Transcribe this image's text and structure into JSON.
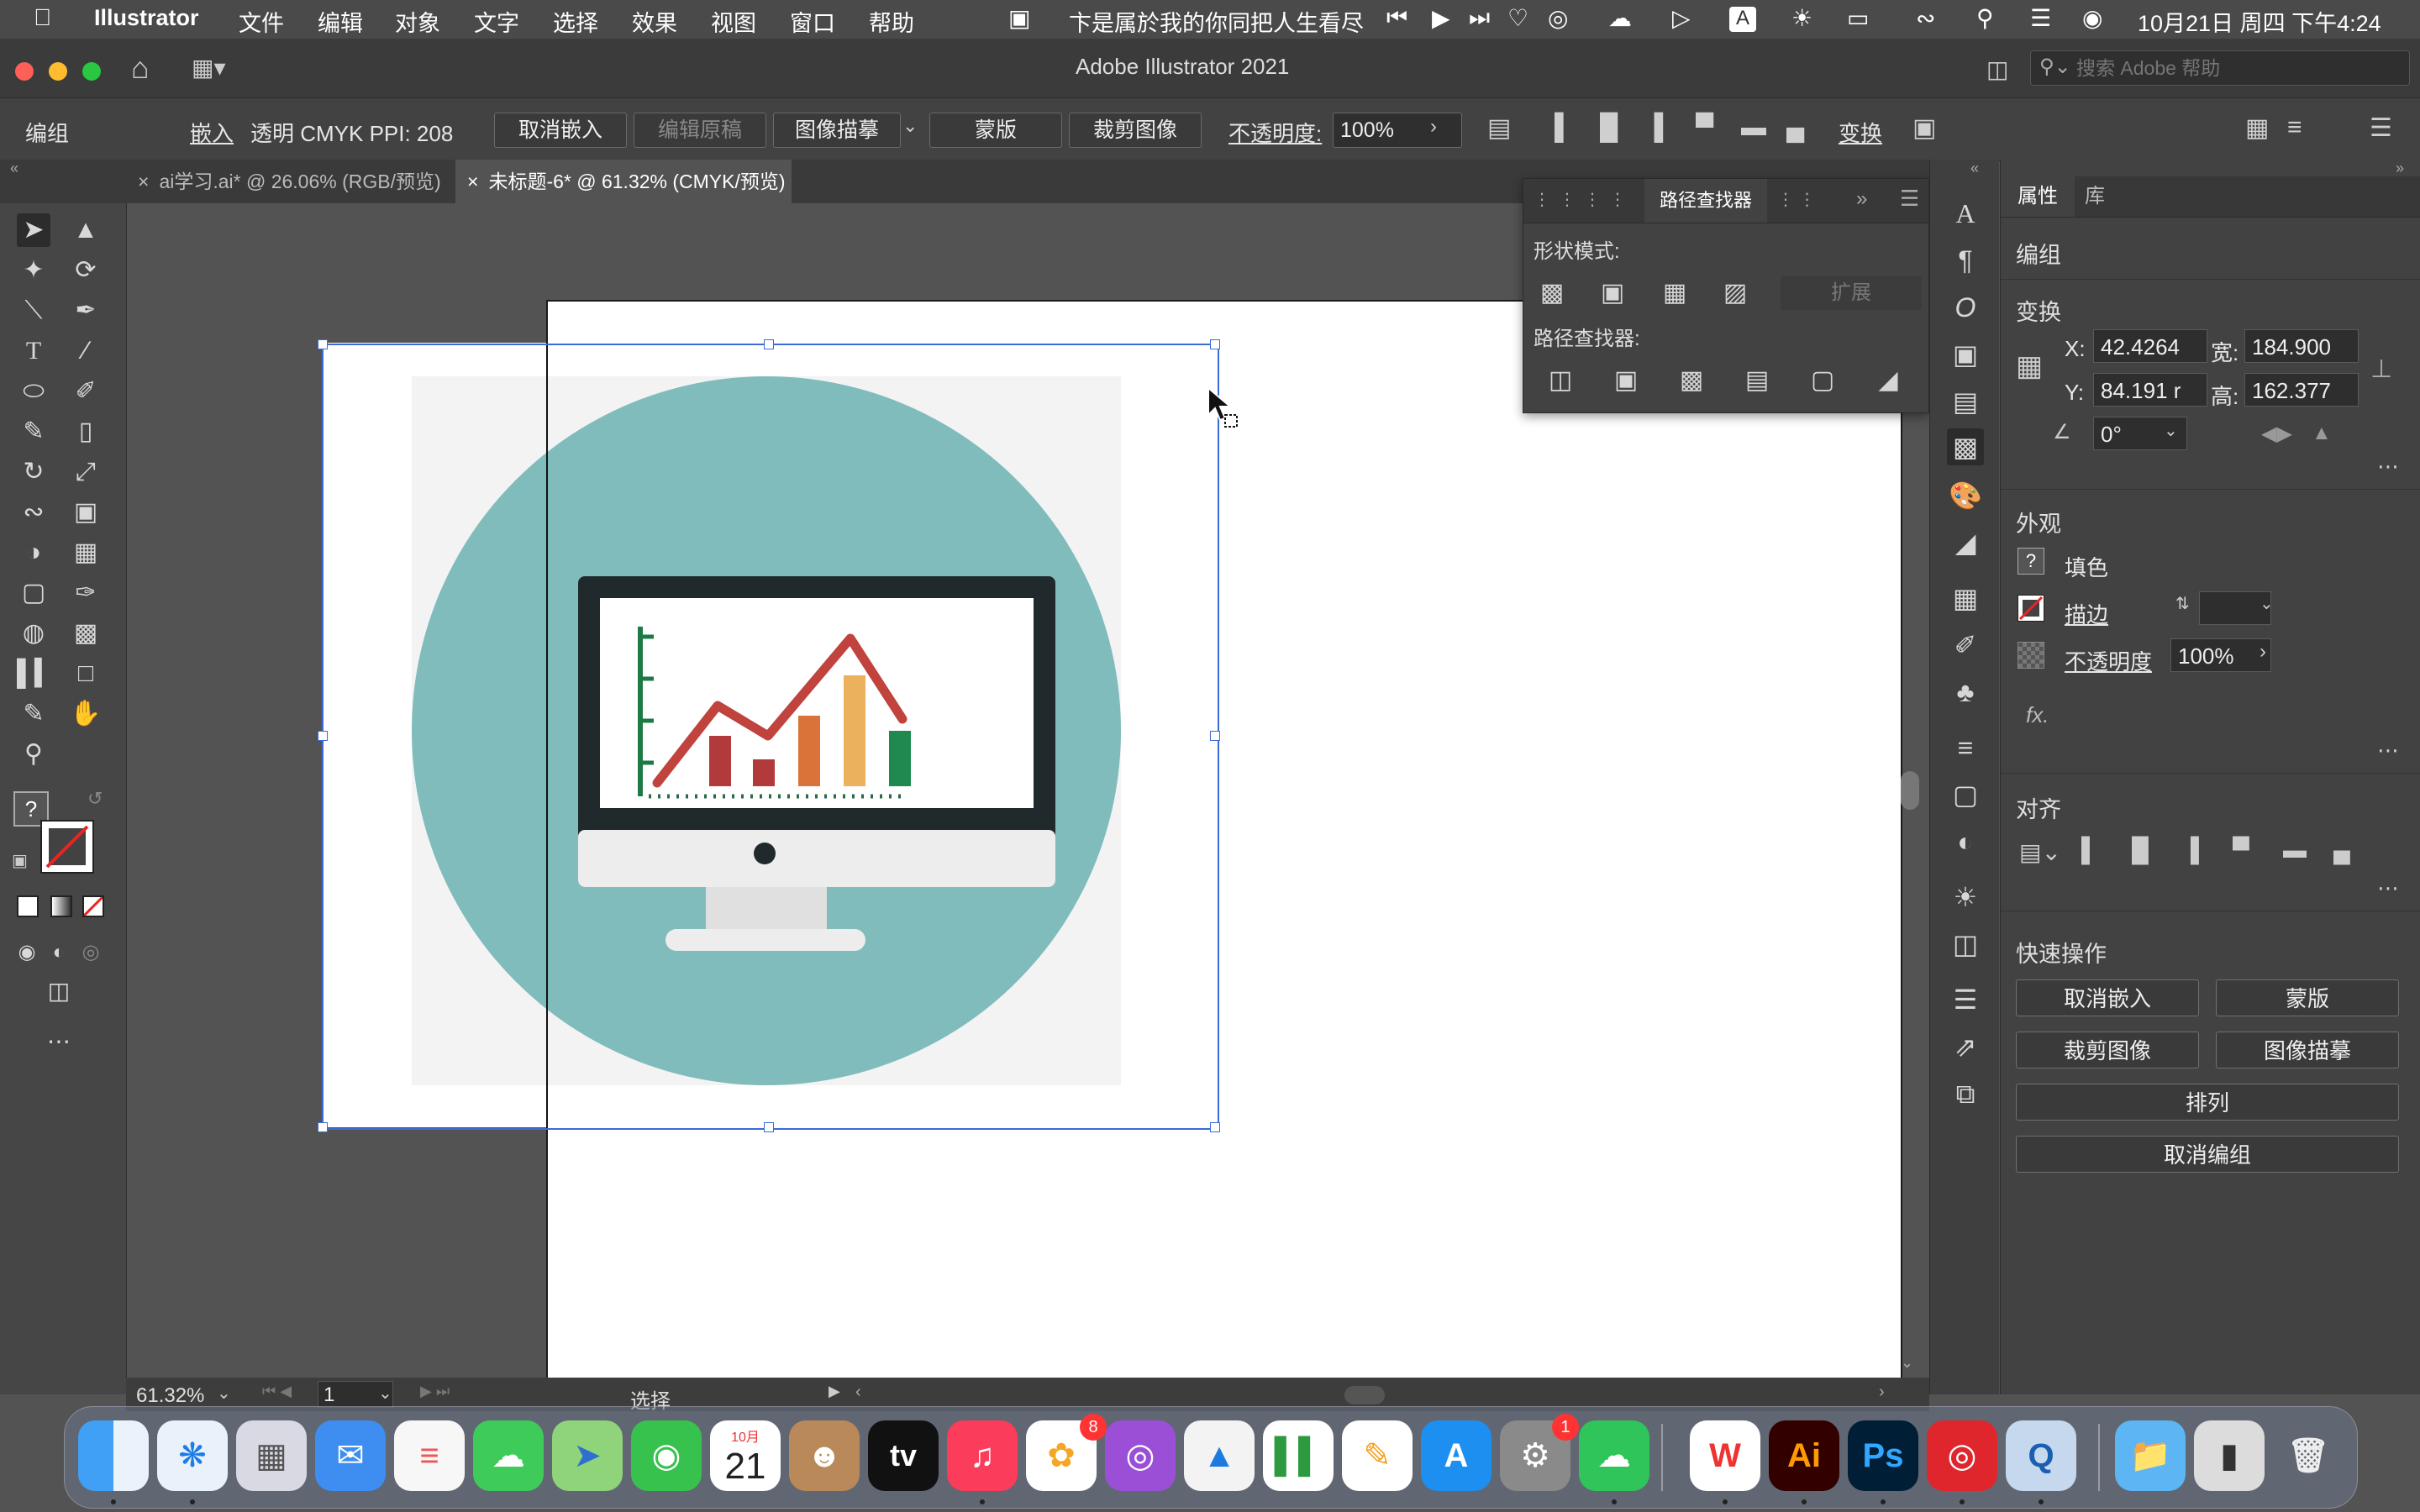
{
  "menubar": {
    "app_name": "Illustrator",
    "menus": [
      "文件",
      "编辑",
      "对象",
      "文字",
      "选择",
      "效果",
      "视图",
      "窗口",
      "帮助"
    ],
    "now_playing": "卞是属於我的你同把人生看尽",
    "clock": "10月21日 周四 下午4:24"
  },
  "window": {
    "title": "Adobe Illustrator 2021",
    "search_placeholder": "搜索 Adobe 帮助"
  },
  "control_bar": {
    "selection_type": "编组",
    "embed_label": "嵌入",
    "info": "透明  CMYK   PPI: 208",
    "unembed": "取消嵌入",
    "edit_original": "编辑原稿",
    "image_trace": "图像描摹",
    "mask": "蒙版",
    "crop_image": "裁剪图像",
    "opacity_label": "不透明度:",
    "opacity_value": "100%",
    "transform": "变换"
  },
  "tabs": [
    {
      "label": "ai学习.ai* @ 26.06% (RGB/预览)",
      "active": false
    },
    {
      "label": "未标题-6* @ 61.32% (CMYK/预览)",
      "active": true
    }
  ],
  "pathfinder_panel": {
    "tab_title": "路径查找器",
    "shape_modes_label": "形状模式:",
    "expand_label": "扩展",
    "pathfinders_label": "路径查找器:"
  },
  "properties": {
    "tabs": [
      "属性",
      "库"
    ],
    "selection": "编组",
    "transform_title": "变换",
    "x_label": "X:",
    "x_value": "42.4264",
    "y_label": "Y:",
    "y_value": "84.191 r",
    "w_label": "宽:",
    "w_value": "184.900",
    "h_label": "高:",
    "h_value": "162.377",
    "angle_value": "0°",
    "appearance_title": "外观",
    "fill_label": "填色",
    "stroke_label": "描边",
    "opacity_label": "不透明度",
    "opacity_value": "100%",
    "fx_label": "fx.",
    "align_title": "对齐",
    "quick_actions_title": "快速操作",
    "qa_unembed": "取消嵌入",
    "qa_mask": "蒙版",
    "qa_crop": "裁剪图像",
    "qa_trace": "图像描摹",
    "qa_arrange": "排列",
    "qa_ungroup": "取消编组"
  },
  "status_bar": {
    "zoom": "61.32%",
    "artboard_num": "1",
    "tool_name": "选择"
  },
  "dock": {
    "calendar_month": "10月",
    "calendar_day": "21",
    "photos_badge": "8",
    "settings_badge": "1",
    "tv_label": "tv",
    "ai_label": "Ai",
    "ps_label": "Ps"
  },
  "colors": {
    "accent_teal": "#80bcbc",
    "chart_line": "#c0433d",
    "selection_blue": "#3b6bd6"
  }
}
